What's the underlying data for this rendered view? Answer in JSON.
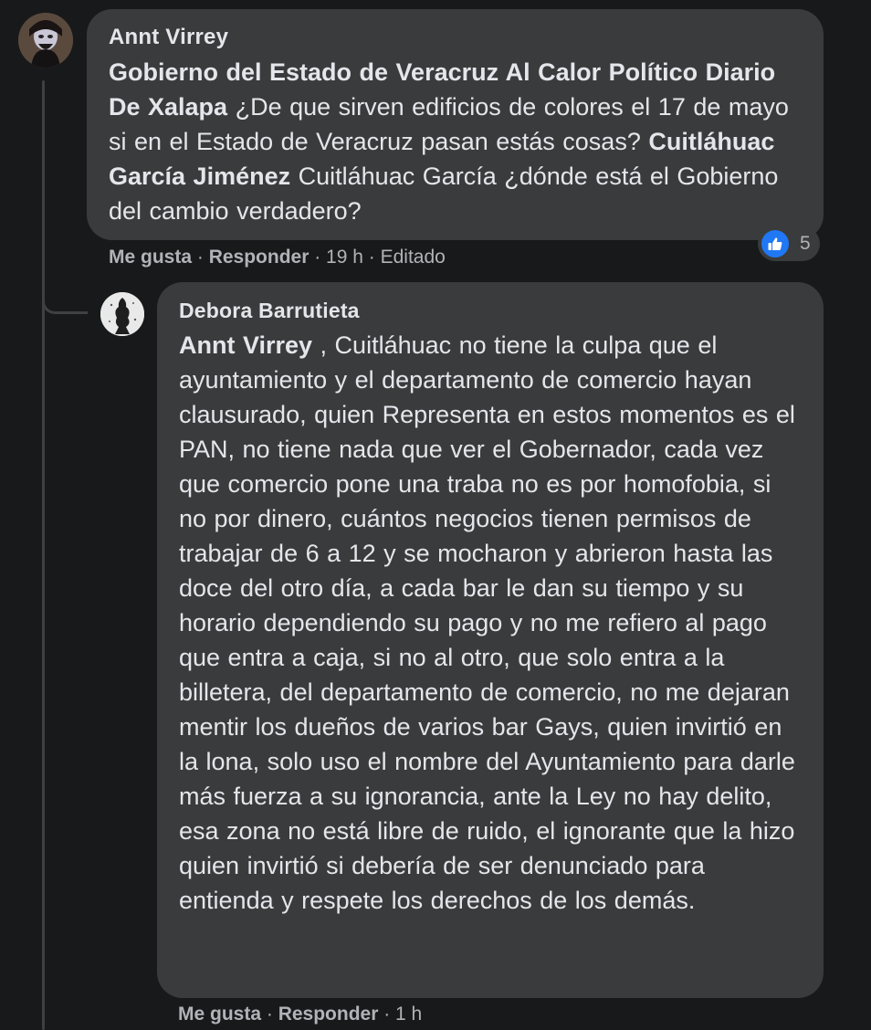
{
  "comments": [
    {
      "author": "Annt Virrey",
      "segments": [
        {
          "text": "Gobierno del Estado de Veracruz Al Calor Político Diario De Xalapa",
          "bold": true
        },
        {
          "text": " ¿De que sirven edificios de colores el 17 de mayo si en el Estado de Veracruz pasan estás cosas? ",
          "bold": false
        },
        {
          "text": "Cuitláhuac García Jiménez",
          "bold": true
        },
        {
          "text": " Cuitláhuac García ¿dónde está el Gobierno del cambio verdadero?",
          "bold": false
        }
      ],
      "actions": {
        "like": "Me gusta",
        "reply": "Responder",
        "time": "19 h",
        "edited": "Editado"
      },
      "reactions": {
        "count": "5",
        "icon": "thumbs-up-icon",
        "color": "#2078f4"
      }
    },
    {
      "author": "Debora Barrutieta",
      "segments": [
        {
          "text": "Annt Virrey",
          "bold": true
        },
        {
          "text": " , Cuitláhuac no tiene la culpa que el ayuntamiento y el departamento de comercio hayan clausurado, quien Representa en estos momentos es el PAN, no tiene nada que ver el Gobernador, cada vez que comercio pone una traba no es por homofobia, si no por dinero, cuántos negocios tienen permisos de trabajar de 6 a 12 y se mocharon y abrieron hasta las doce del otro día, a cada bar le dan su tiempo y su horario dependiendo su pago y no me refiero al pago que entra a caja, si no al otro, que solo entra a la billetera, del departamento de comercio, no me dejaran mentir los dueños de varios bar Gays, quien invirtió en la lona, solo uso el nombre del Ayuntamiento para darle más fuerza a su ignorancia, ante la Ley no hay delito, esa zona no está libre de ruido, el ignorante que la hizo quien invirtió si debería de ser denunciado para entienda y respete los derechos de los demás.",
          "bold": false
        }
      ],
      "actions": {
        "like": "Me gusta",
        "reply": "Responder",
        "time": "1 h"
      }
    }
  ],
  "separator": " · "
}
